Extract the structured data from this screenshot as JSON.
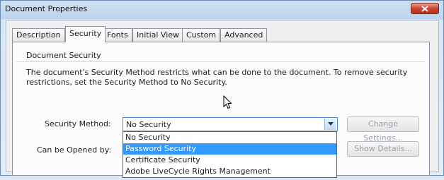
{
  "window": {
    "title": "Document Properties"
  },
  "tabs": [
    {
      "label": "Description",
      "active": false
    },
    {
      "label": "Security",
      "active": true
    },
    {
      "label": "Fonts",
      "active": false
    },
    {
      "label": "Initial View",
      "active": false
    },
    {
      "label": "Custom",
      "active": false
    },
    {
      "label": "Advanced",
      "active": false
    }
  ],
  "security": {
    "group_title": "Document Security",
    "description": "The document's Security Method restricts what can be done to the document. To remove security restrictions, set the Security Method to No Security.",
    "method_label": "Security Method:",
    "method_value": "No Security",
    "opened_label": "Can be Opened by:",
    "change_settings_label": "Change Settings...",
    "show_details_label": "Show Details..."
  },
  "dropdown": {
    "options": [
      "No Security",
      "Password Security",
      "Certificate Security",
      "Adobe LiveCycle Rights Management"
    ],
    "highlighted": "Password Security"
  },
  "colors": {
    "highlight": "#3399ff",
    "close_button": "#c9442f",
    "disabled_text": "#9aa1a9"
  }
}
